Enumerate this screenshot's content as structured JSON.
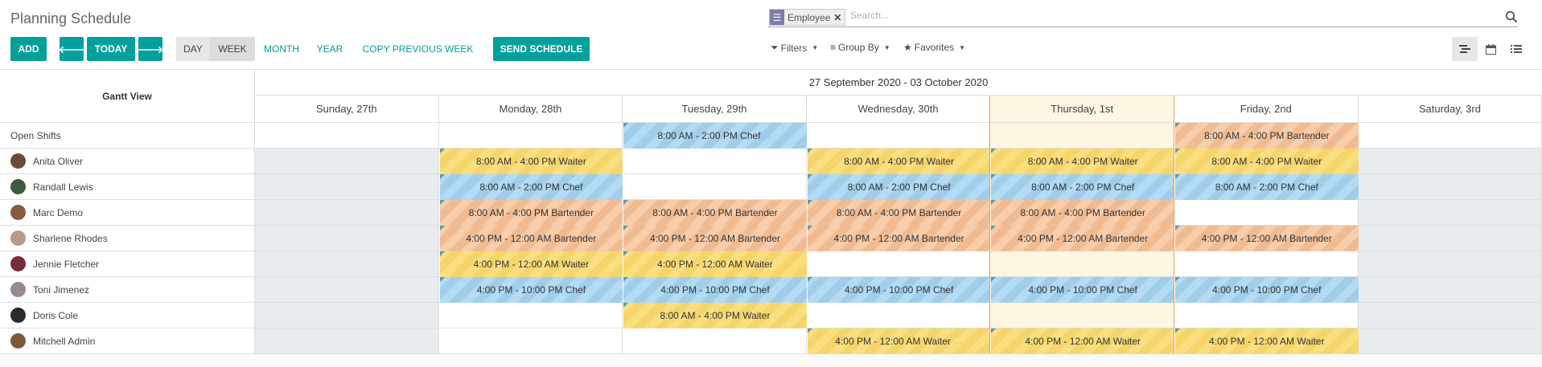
{
  "title": "Planning Schedule",
  "search": {
    "facet_label": "Employee",
    "placeholder": "Search..."
  },
  "buttons": {
    "add": "ADD",
    "today": "TODAY",
    "day": "DAY",
    "week": "WEEK",
    "month": "MONTH",
    "year": "YEAR",
    "copy_previous_week": "COPY PREVIOUS WEEK",
    "send_schedule": "SEND SCHEDULE"
  },
  "filters": {
    "filters": "Filters",
    "group_by": "Group By",
    "favorites": "Favorites"
  },
  "gantt": {
    "label": "Gantt View",
    "range": "27 September 2020 - 03 October 2020",
    "days": [
      "Sunday, 27th",
      "Monday, 28th",
      "Tuesday, 29th",
      "Wednesday, 30th",
      "Thursday, 1st",
      "Friday, 2nd",
      "Saturday, 3rd"
    ],
    "rows": [
      "Open Shifts",
      "Anita Oliver",
      "Randall Lewis",
      "Marc Demo",
      "Sharlene Rhodes",
      "Jennie Fletcher",
      "Toni Jimenez",
      "Doris Cole",
      "Mitchell Admin"
    ],
    "shifts": [
      {
        "row": 0,
        "day": 2,
        "text": "8:00 AM - 2:00 PM Chef",
        "role": "chef",
        "more": "…"
      },
      {
        "row": 0,
        "day": 5,
        "text": "8:00 AM - 4:00 PM Bartender",
        "role": "bartender"
      },
      {
        "row": 1,
        "day": 1,
        "text": "8:00 AM - 4:00 PM Waiter",
        "role": "waiter"
      },
      {
        "row": 1,
        "day": 3,
        "text": "8:00 AM - 4:00 PM Waiter",
        "role": "waiter"
      },
      {
        "row": 1,
        "day": 4,
        "text": "8:00 AM - 4:00 PM Waiter",
        "role": "waiter"
      },
      {
        "row": 1,
        "day": 5,
        "text": "8:00 AM - 4:00 PM Waiter",
        "role": "waiter"
      },
      {
        "row": 2,
        "day": 1,
        "text": "8:00 AM - 2:00 PM Chef",
        "role": "chef"
      },
      {
        "row": 2,
        "day": 3,
        "text": "8:00 AM - 2:00 PM Chef",
        "role": "chef"
      },
      {
        "row": 2,
        "day": 4,
        "text": "8:00 AM - 2:00 PM Chef",
        "role": "chef"
      },
      {
        "row": 2,
        "day": 5,
        "text": "8:00 AM - 2:00 PM Chef",
        "role": "chef"
      },
      {
        "row": 3,
        "day": 1,
        "text": "8:00 AM - 4:00 PM Bartender",
        "role": "bartender"
      },
      {
        "row": 3,
        "day": 2,
        "text": "8:00 AM - 4:00 PM Bartender",
        "role": "bartender"
      },
      {
        "row": 3,
        "day": 3,
        "text": "8:00 AM - 4:00 PM Bartender",
        "role": "bartender"
      },
      {
        "row": 3,
        "day": 4,
        "text": "8:00 AM - 4:00 PM Bartender",
        "role": "bartender"
      },
      {
        "row": 4,
        "day": 1,
        "text": "4:00 PM - 12:00 AM Bartender",
        "role": "bartender"
      },
      {
        "row": 4,
        "day": 2,
        "text": "4:00 PM - 12:00 AM Bartender",
        "role": "bartender"
      },
      {
        "row": 4,
        "day": 3,
        "text": "4:00 PM - 12:00 AM Bartender",
        "role": "bartender"
      },
      {
        "row": 4,
        "day": 4,
        "text": "4:00 PM - 12:00 AM Bartender",
        "role": "bartender"
      },
      {
        "row": 4,
        "day": 5,
        "text": "4:00 PM - 12:00 AM Bartender",
        "role": "bartender"
      },
      {
        "row": 5,
        "day": 1,
        "text": "4:00 PM - 12:00 AM Waiter",
        "role": "waiter"
      },
      {
        "row": 5,
        "day": 2,
        "text": "4:00 PM - 12:00 AM Waiter",
        "role": "waiter"
      },
      {
        "row": 6,
        "day": 1,
        "text": "4:00 PM - 10:00 PM Chef",
        "role": "chef"
      },
      {
        "row": 6,
        "day": 2,
        "text": "4:00 PM - 10:00 PM Chef",
        "role": "chef"
      },
      {
        "row": 6,
        "day": 3,
        "text": "4:00 PM - 10:00 PM Chef",
        "role": "chef"
      },
      {
        "row": 6,
        "day": 4,
        "text": "4:00 PM - 10:00 PM Chef",
        "role": "chef"
      },
      {
        "row": 6,
        "day": 5,
        "text": "4:00 PM - 10:00 PM Chef",
        "role": "chef"
      },
      {
        "row": 7,
        "day": 2,
        "text": "8:00 AM - 4:00 PM Waiter",
        "role": "waiter"
      },
      {
        "row": 8,
        "day": 3,
        "text": "4:00 PM - 12:00 AM Waiter",
        "role": "waiter",
        "more": "…"
      },
      {
        "row": 8,
        "day": 4,
        "text": "4:00 PM - 12:00 AM Waiter",
        "role": "waiter"
      },
      {
        "row": 8,
        "day": 5,
        "text": "4:00 PM - 12:00 AM Waiter",
        "role": "waiter"
      }
    ]
  },
  "colors": {
    "primary": "#00a09d",
    "waiter": "#f9df7f",
    "chef": "#a9d6f1",
    "bartender": "#f5c5a0",
    "today_bg": "#fdf6e3",
    "unavailable": "#e9ecef"
  },
  "icons": {
    "facet": "list-icon",
    "search": "magnifier-icon",
    "prev": "arrow-left-icon",
    "next": "arrow-right-icon",
    "gantt_view": "gantt-icon",
    "calendar_view": "calendar-icon",
    "list_view": "list-view-icon"
  }
}
